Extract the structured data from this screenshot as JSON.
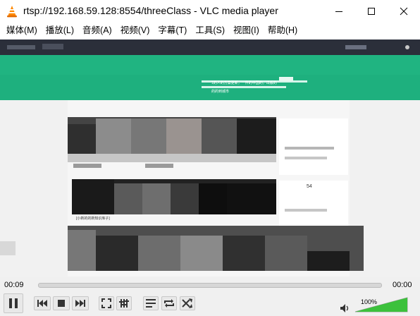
{
  "window": {
    "title": "rtsp://192.168.59.128:8554/threeClass - VLC media player"
  },
  "menu": [
    {
      "label": "媒体(M)"
    },
    {
      "label": "播放(L)"
    },
    {
      "label": "音频(A)"
    },
    {
      "label": "视频(V)"
    },
    {
      "label": "字幕(T)"
    },
    {
      "label": "工具(S)"
    },
    {
      "label": "视图(I)"
    },
    {
      "label": "帮助(H)"
    }
  ],
  "video": {
    "caption_lines": [
      "1的人的方案更新，一件的中国的，出版的",
      "的的到城市"
    ],
    "side_number": "54",
    "card_title": "[小新的的新知识库子]"
  },
  "playback": {
    "elapsed": "00:09",
    "remaining": "00:00",
    "progress": 0.0
  },
  "volume": {
    "label": "100%",
    "level": 1.0
  },
  "icons": {
    "logo": "vlc-cone-icon",
    "minimize": "minimize-icon",
    "maximize": "maximize-icon",
    "close": "close-icon",
    "pause": "pause-icon",
    "previous": "previous-icon",
    "stop": "stop-icon",
    "next": "next-icon",
    "fullscreen": "fullscreen-icon",
    "extended": "extended-settings-icon",
    "playlist": "playlist-icon",
    "loop": "loop-icon",
    "shuffle": "shuffle-icon",
    "speaker": "speaker-icon"
  },
  "colors": {
    "accent_green": "#20b481",
    "vlc_orange": "#ff8800",
    "volume_green": "#3cc13c"
  }
}
